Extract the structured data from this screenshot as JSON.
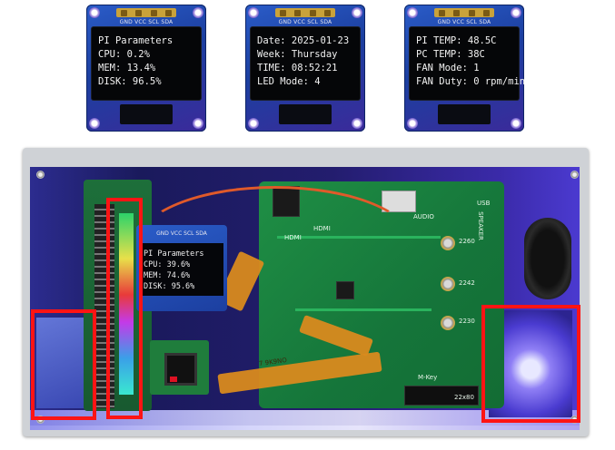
{
  "oleds": [
    {
      "pin_label": "GND VCC SCL SDA",
      "lines": [
        "PI Parameters",
        "CPU: 0.2%",
        "MEM: 13.4%",
        "DISK: 96.5%"
      ]
    },
    {
      "pin_label": "GND VCC SCL SDA",
      "lines": [
        "Date: 2025-01-23",
        "Week: Thursday",
        "TIME: 08:52:21",
        "LED Mode: 4"
      ]
    },
    {
      "pin_label": "GND VCC SCL SDA",
      "lines": [
        "PI TEMP: 48.5C",
        "PC TEMP: 38C",
        "FAN Mode: 1",
        "FAN Duty: 0 rpm/min"
      ]
    }
  ],
  "embedded_oled": {
    "pin_label": "GND VCC SCL SDA",
    "lines": [
      "PI Parameters",
      "CPU: 39.6%",
      "MEM: 74.6%",
      "DISK: 95.6%"
    ]
  },
  "board_labels": {
    "audio": "AUDIO",
    "speaker": "SPEAKER",
    "usb": "USB",
    "hdmi_a": "HDMI",
    "hdmi_b": "HDMI",
    "m2_a": "2260",
    "m2_b": "2242",
    "m2_c": "2230",
    "m2_key": "M-Key",
    "ssd": "22x80",
    "flex_label": "7 9K9NO"
  },
  "highlight_color": "#ff1414"
}
